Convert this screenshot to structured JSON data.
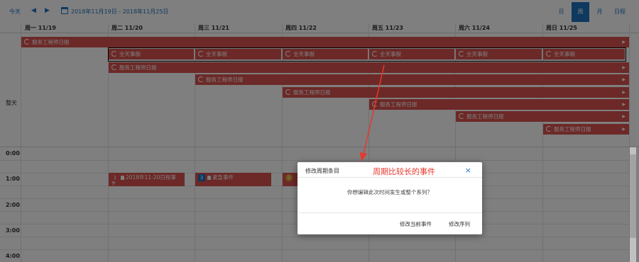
{
  "toolbar": {
    "today": "今天",
    "prev": "◀",
    "next": "▶",
    "range": "2018年11月19日 - 2018年11月25日",
    "views": [
      {
        "label": "日",
        "active": false
      },
      {
        "label": "周",
        "active": true
      },
      {
        "label": "月",
        "active": false
      },
      {
        "label": "日程",
        "active": false
      }
    ]
  },
  "columns": [
    "周一 11/19",
    "周二 11/20",
    "周三 11/21",
    "周四 11/22",
    "周五 11/23",
    "周六 11/24",
    "周日 11/25"
  ],
  "allday_label": "整天",
  "allday_events": {
    "service_log": "服务工程师日报",
    "all_day_leave": "全天事假",
    "more_arrow": "▶"
  },
  "time_labels": [
    "0:00",
    "1:00",
    "2:00",
    "3:00",
    "4:00"
  ],
  "timed_events": [
    {
      "badge": "1",
      "text": "2018年11-20日程事",
      "sub": "件"
    },
    {
      "badge": "3",
      "text": "紧急事件"
    },
    {
      "badge": "2",
      "text": ""
    }
  ],
  "colors": {
    "event": "#d9534f",
    "accent": "#1e73be",
    "annotation": "#e8372b"
  },
  "modal": {
    "title": "修改周期条目",
    "close": "×",
    "message": "你想编辑此次时间发生或整个系列？",
    "btn_current": "修改当前事件",
    "btn_series": "修改序列"
  },
  "annotation": "周期比较长的事件"
}
